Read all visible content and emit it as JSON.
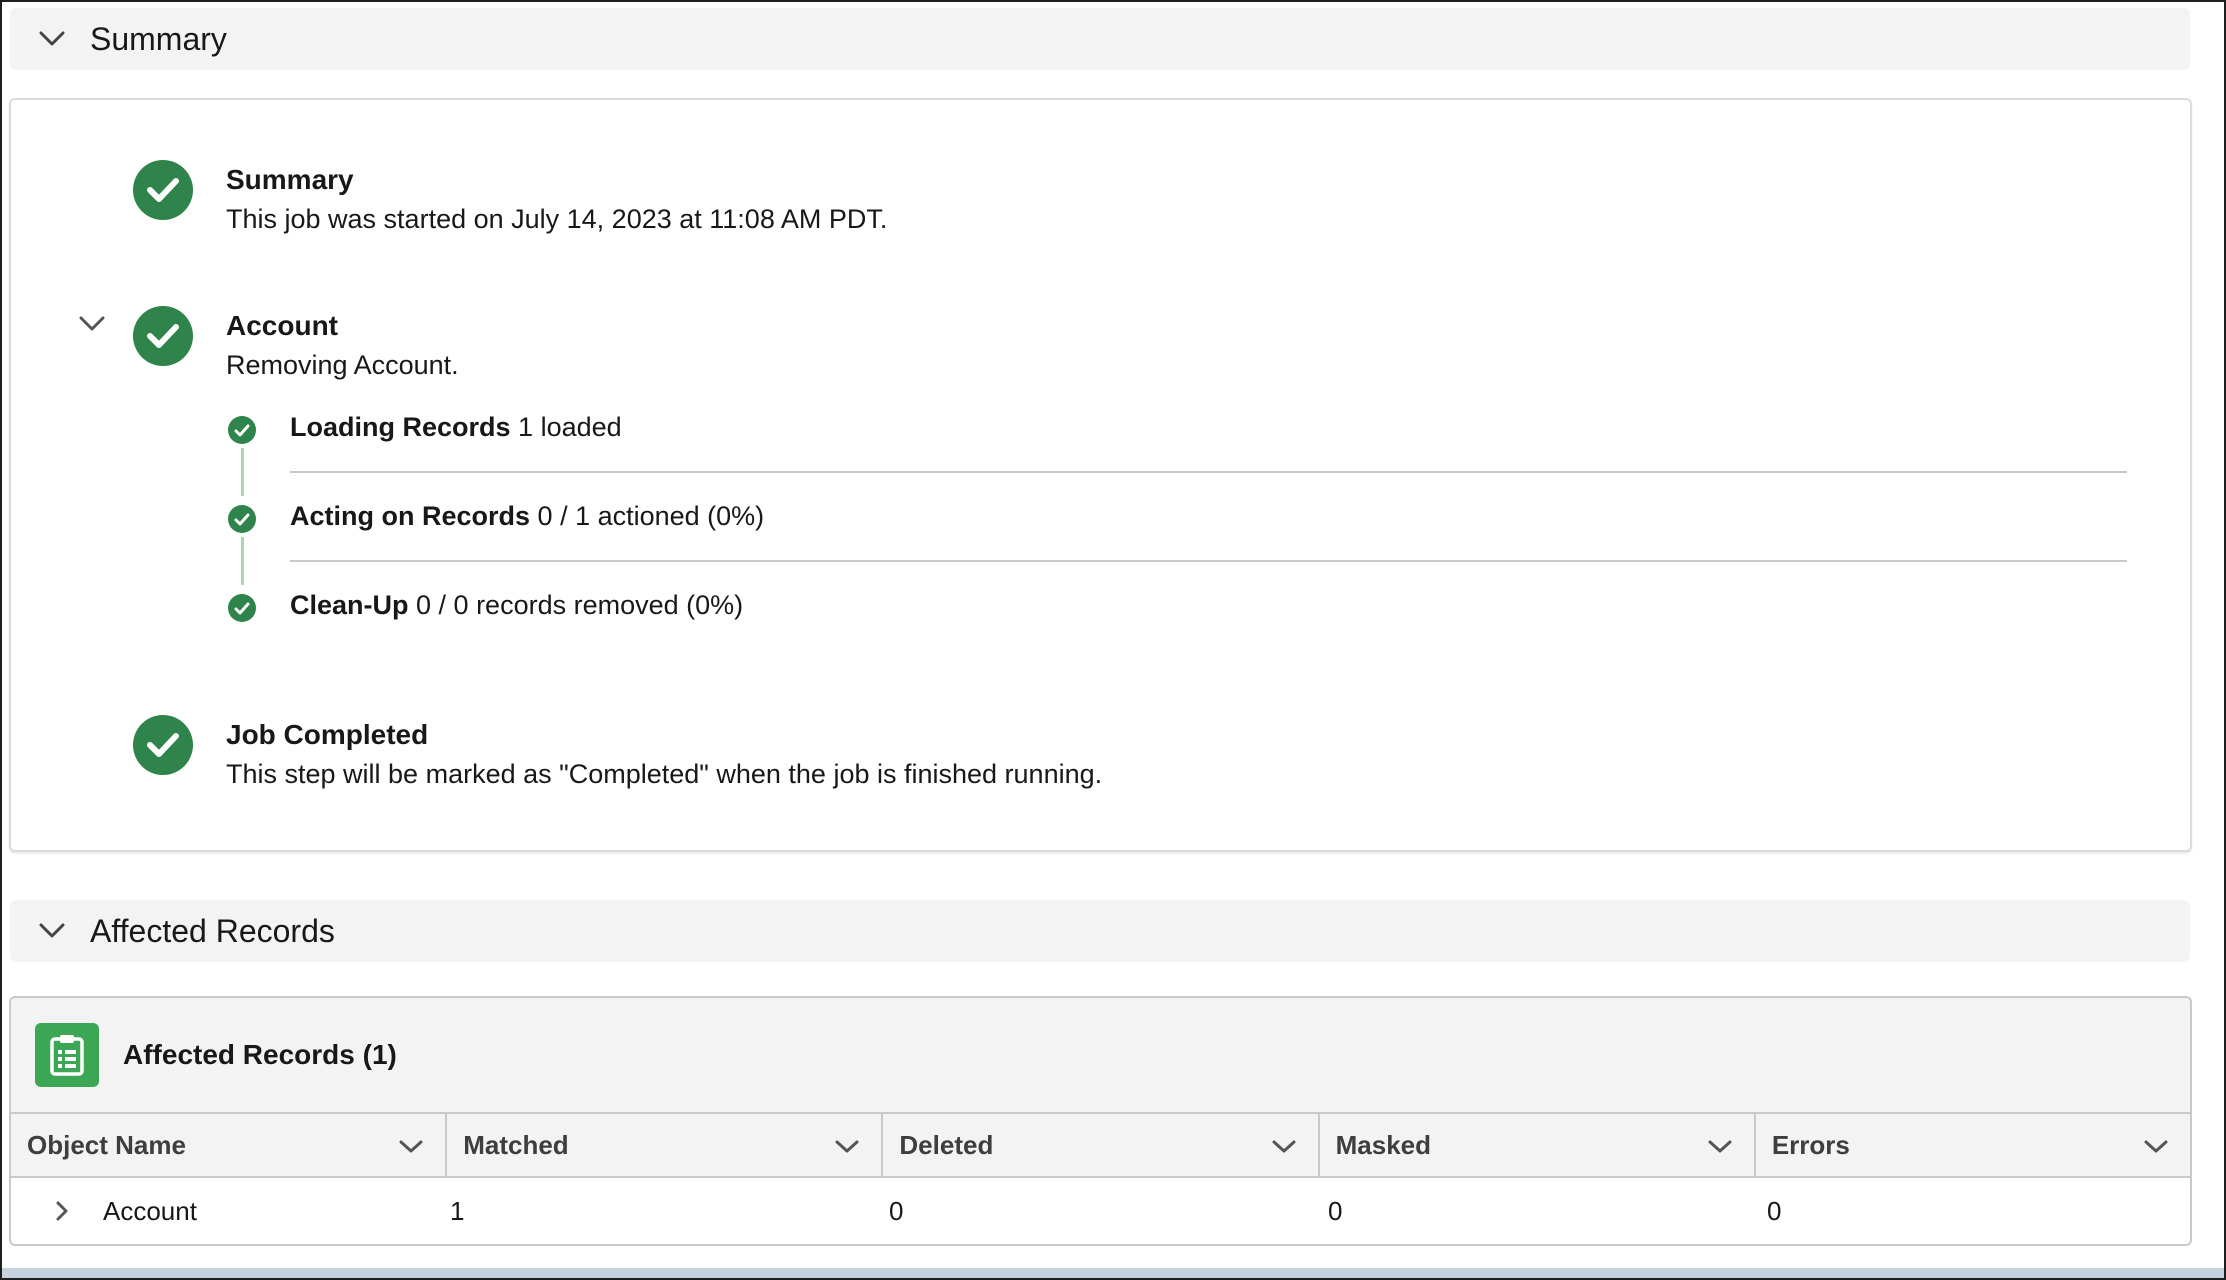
{
  "summary_section": {
    "header_title": "Summary",
    "steps": {
      "summary": {
        "title": "Summary",
        "description": "This job was started on July 14, 2023 at 11:08 AM PDT."
      },
      "account": {
        "title": "Account",
        "description": "Removing Account.",
        "substeps": [
          {
            "label": "Loading Records",
            "detail": "1 loaded"
          },
          {
            "label": "Acting on Records",
            "detail": "0 / 1 actioned (0%)"
          },
          {
            "label": "Clean-Up",
            "detail": "0 / 0 records removed (0%)"
          }
        ]
      },
      "job_completed": {
        "title": "Job Completed",
        "description": "This step will be marked as \"Completed\" when the job is finished running."
      }
    }
  },
  "affected_section": {
    "header_title": "Affected Records",
    "card_title": "Affected Records (1)",
    "icon": "clipboard-list-icon",
    "columns": [
      "Object Name",
      "Matched",
      "Deleted",
      "Masked",
      "Errors"
    ],
    "rows": [
      {
        "object_name": "Account",
        "matched": "1",
        "deleted": "0",
        "masked": "0",
        "errors": "0"
      }
    ]
  },
  "colors": {
    "success": "#2e844a",
    "icon_green": "#3ba755",
    "header_bg": "#f3f3f3"
  }
}
